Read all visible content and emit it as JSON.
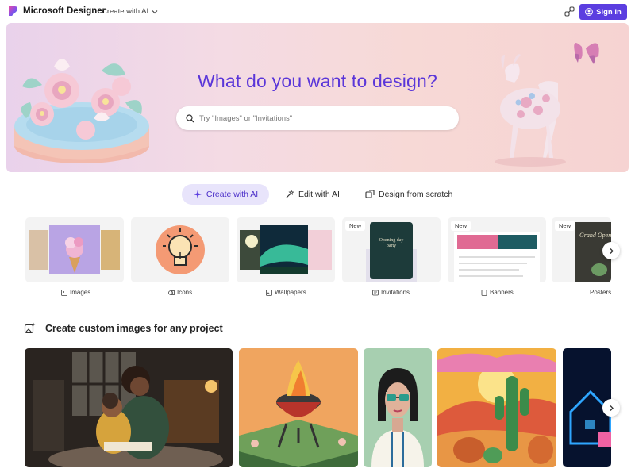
{
  "header": {
    "brand": "Microsoft Designer",
    "create_menu": "Create with AI",
    "signin": "Sign in"
  },
  "hero": {
    "title": "What do you want to design?",
    "search_placeholder": "Try \"Images\" or \"Invitations\""
  },
  "tabs": [
    {
      "label": "Create with AI",
      "active": true,
      "icon": "sparkle-icon"
    },
    {
      "label": "Edit with AI",
      "active": false,
      "icon": "magic-wand-icon"
    },
    {
      "label": "Design from scratch",
      "active": false,
      "icon": "design-icon"
    }
  ],
  "categories": [
    {
      "label": "Images",
      "icon": "image-icon",
      "new": false
    },
    {
      "label": "Icons",
      "icon": "icon-shape-icon",
      "new": false
    },
    {
      "label": "Wallpapers",
      "icon": "wallpaper-icon",
      "new": false
    },
    {
      "label": "Invitations",
      "icon": "invitation-icon",
      "new": true,
      "badge": "New",
      "card_title": "Opening day party"
    },
    {
      "label": "Banners",
      "icon": "banner-icon",
      "new": true,
      "badge": "New"
    },
    {
      "label": "Posters",
      "icon": "poster-icon",
      "new": true,
      "badge": "New",
      "card_title": "Grand Open"
    }
  ],
  "section": {
    "title": "Create custom images for any project"
  },
  "colors": {
    "accent": "#5b3ee0",
    "hero_title": "#5a36d9",
    "tab_active_bg": "#e8e4fb"
  }
}
